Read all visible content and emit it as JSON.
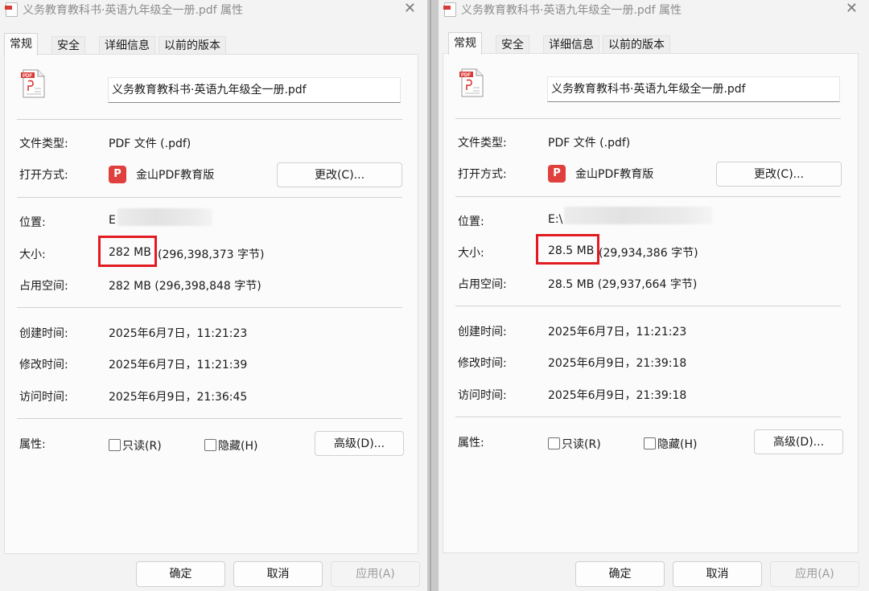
{
  "windows": {
    "left": {
      "title": "义务教育教科书·英语九年级全一册.pdf 属性",
      "tabs": [
        "常规",
        "安全",
        "详细信息",
        "以前的版本"
      ],
      "filename": "义务教育教科书·英语九年级全一册.pdf",
      "labels": {
        "type": "文件类型:",
        "open_with": "打开方式:",
        "location": "位置:",
        "size": "大小:",
        "size_on_disk": "占用空间:",
        "created": "创建时间:",
        "modified": "修改时间:",
        "accessed": "访问时间:",
        "attributes": "属性:"
      },
      "values": {
        "type": "PDF 文件 (.pdf)",
        "app": "金山PDF教育版",
        "location": "E",
        "size_highlight": "282 MB",
        "size_rest": "(296,398,373 字节)",
        "size_on_disk": "282 MB (296,398,848 字节)",
        "created": "2025年6月7日，11:21:23",
        "modified": "2025年6月7日，11:21:39",
        "accessed": "2025年6月9日，21:36:45"
      },
      "buttons": {
        "change": "更改(C)...",
        "advanced": "高级(D)...",
        "ok": "确定",
        "cancel": "取消",
        "apply": "应用(A)"
      },
      "checkboxes": {
        "readonly": "只读(R)",
        "hidden": "隐藏(H)"
      }
    },
    "right": {
      "title": "义务教育教科书·英语九年级全一册.pdf 属性",
      "tabs": [
        "常规",
        "安全",
        "详细信息",
        "以前的版本"
      ],
      "filename": "义务教育教科书·英语九年级全一册.pdf",
      "labels": {
        "type": "文件类型:",
        "open_with": "打开方式:",
        "location": "位置:",
        "size": "大小:",
        "size_on_disk": "占用空间:",
        "created": "创建时间:",
        "modified": "修改时间:",
        "accessed": "访问时间:",
        "attributes": "属性:"
      },
      "values": {
        "type": "PDF 文件 (.pdf)",
        "app": "金山PDF教育版",
        "location": "E:\\",
        "size_highlight": "28.5 MB",
        "size_rest": "(29,934,386 字节)",
        "size_on_disk": "28.5 MB (29,937,664 字节)",
        "created": "2025年6月7日，11:21:23",
        "modified": "2025年6月9日，21:39:18",
        "accessed": "2025年6月9日，21:39:18"
      },
      "buttons": {
        "change": "更改(C)...",
        "advanced": "高级(D)...",
        "ok": "确定",
        "cancel": "取消",
        "apply": "应用(A)"
      },
      "checkboxes": {
        "readonly": "只读(R)",
        "hidden": "隐藏(H)"
      }
    }
  },
  "colors": {
    "highlight": "#e21b23",
    "app_icon": "#e0403d"
  },
  "icons": {
    "pdf": "pdf-file-icon",
    "app": "kingsoft-pdf-icon",
    "close": "close-icon"
  }
}
